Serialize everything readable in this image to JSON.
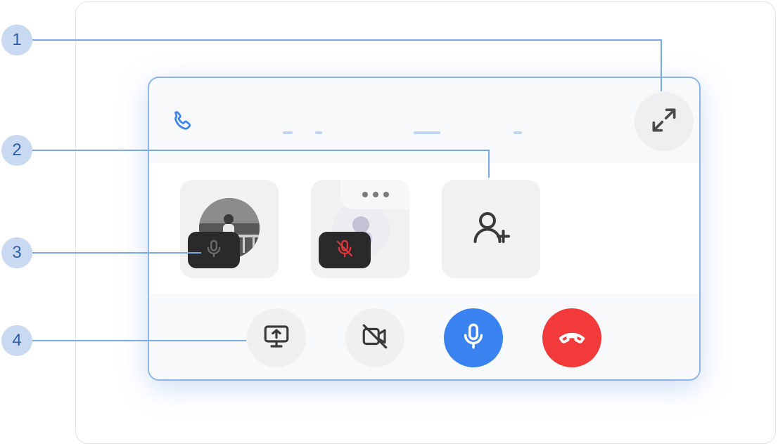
{
  "callouts": [
    {
      "num": "1"
    },
    {
      "num": "2"
    },
    {
      "num": "3"
    },
    {
      "num": "4"
    }
  ],
  "header": {
    "phone_icon": "phone-icon",
    "expand_icon": "expand-icon"
  },
  "participants": [
    {
      "name": "participant-1",
      "mic_state": "on"
    },
    {
      "name": "participant-2",
      "mic_state": "muted",
      "more_icon": "more-icon"
    },
    {
      "name": "add-participant",
      "icon": "add-user-icon"
    }
  ],
  "controls": [
    {
      "name": "screen-share",
      "icon": "screen-share-icon"
    },
    {
      "name": "camera",
      "icon": "camera-off-icon",
      "state": "off"
    },
    {
      "name": "microphone",
      "icon": "microphone-icon",
      "state": "on"
    },
    {
      "name": "hang-up",
      "icon": "hang-up-icon"
    }
  ],
  "colors": {
    "accent": "#3a82f0",
    "danger": "#f23a3a",
    "callout": "#7aa9e8"
  }
}
